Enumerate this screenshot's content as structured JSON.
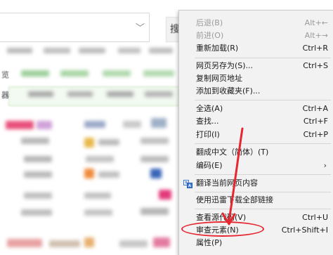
{
  "background": {
    "search_button_label": "搜",
    "nav_row_1_label": "览",
    "nav_row_2_label": "器"
  },
  "context_menu": {
    "items": [
      {
        "label": "后退(B)",
        "shortcut": "Alt+←",
        "enabled": false
      },
      {
        "label": "前进(O)",
        "shortcut": "Alt+→",
        "enabled": false
      },
      {
        "label": "重新加载(R)",
        "shortcut": "Ctrl+R",
        "enabled": true
      },
      {
        "label": "网页另存为(S)...",
        "shortcut": "Ctrl+S",
        "enabled": true
      },
      {
        "label": "复制网页地址",
        "shortcut": "",
        "enabled": true
      },
      {
        "label": "添加到收藏夹(F)...",
        "shortcut": "",
        "enabled": true
      },
      {
        "label": "全选(A)",
        "shortcut": "Ctrl+A",
        "enabled": true
      },
      {
        "label": "查找...",
        "shortcut": "Ctrl+F",
        "enabled": true
      },
      {
        "label": "打印(I)",
        "shortcut": "Ctrl+P",
        "enabled": true
      },
      {
        "label": "翻成中文（简体）(T)",
        "shortcut": "",
        "enabled": true
      },
      {
        "label": "编码(E)",
        "shortcut": "",
        "enabled": true,
        "submenu": true
      },
      {
        "label": "翻译当前网页内容",
        "shortcut": "",
        "enabled": true,
        "icon": "translate-icon"
      },
      {
        "label": "使用迅雷下载全部链接",
        "shortcut": "",
        "enabled": true
      },
      {
        "label": "查看源代码(V)",
        "shortcut": "Ctrl+U",
        "enabled": true
      },
      {
        "label": "审查元素(N)",
        "shortcut": "Ctrl+Shift+I",
        "enabled": true,
        "highlighted": true
      },
      {
        "label": "属性(P)",
        "shortcut": "",
        "enabled": true
      }
    ],
    "submenu_arrow": "›"
  },
  "annotation_color": "#e8262f"
}
